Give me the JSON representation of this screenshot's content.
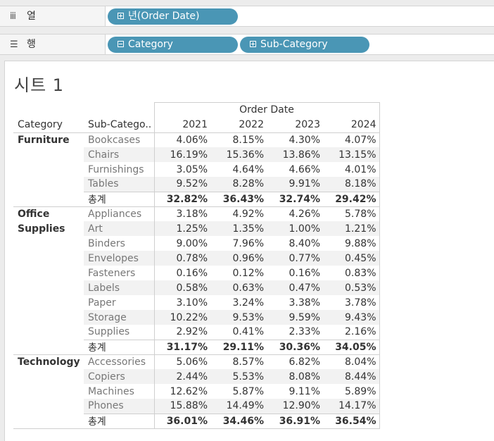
{
  "columns_shelf": {
    "label": "열",
    "icon": "columns-icon",
    "pill": "년(Order Date)"
  },
  "rows_shelf": {
    "label": "행",
    "icon": "rows-icon",
    "pills": [
      "Category",
      "Sub-Category"
    ]
  },
  "sheet": {
    "title": "시트 1",
    "column_group_header": "Order Date",
    "row_headers": [
      "Category",
      "Sub-Catego.."
    ],
    "years": [
      "2021",
      "2022",
      "2023",
      "2024"
    ],
    "total_label": "총계",
    "groups": [
      {
        "category": "Furniture",
        "rows": [
          {
            "sub": "Bookcases",
            "values": [
              "4.06%",
              "8.15%",
              "4.30%",
              "4.07%"
            ]
          },
          {
            "sub": "Chairs",
            "values": [
              "16.19%",
              "15.36%",
              "13.86%",
              "13.15%"
            ]
          },
          {
            "sub": "Furnishings",
            "values": [
              "3.05%",
              "4.64%",
              "4.66%",
              "4.01%"
            ]
          },
          {
            "sub": "Tables",
            "values": [
              "9.52%",
              "8.28%",
              "9.91%",
              "8.18%"
            ]
          }
        ],
        "total": [
          "32.82%",
          "36.43%",
          "32.74%",
          "29.42%"
        ]
      },
      {
        "category": "Office Supplies",
        "category_lines": [
          "Office",
          "Supplies"
        ],
        "rows": [
          {
            "sub": "Appliances",
            "values": [
              "3.18%",
              "4.92%",
              "4.26%",
              "5.78%"
            ]
          },
          {
            "sub": "Art",
            "values": [
              "1.25%",
              "1.35%",
              "1.00%",
              "1.21%"
            ]
          },
          {
            "sub": "Binders",
            "values": [
              "9.00%",
              "7.96%",
              "8.40%",
              "9.88%"
            ]
          },
          {
            "sub": "Envelopes",
            "values": [
              "0.78%",
              "0.96%",
              "0.77%",
              "0.45%"
            ]
          },
          {
            "sub": "Fasteners",
            "values": [
              "0.16%",
              "0.12%",
              "0.16%",
              "0.83%"
            ]
          },
          {
            "sub": "Labels",
            "values": [
              "0.58%",
              "0.63%",
              "0.47%",
              "0.53%"
            ]
          },
          {
            "sub": "Paper",
            "values": [
              "3.10%",
              "3.24%",
              "3.38%",
              "3.78%"
            ]
          },
          {
            "sub": "Storage",
            "values": [
              "10.22%",
              "9.53%",
              "9.59%",
              "9.43%"
            ]
          },
          {
            "sub": "Supplies",
            "values": [
              "2.92%",
              "0.41%",
              "2.33%",
              "2.16%"
            ]
          }
        ],
        "total": [
          "31.17%",
          "29.11%",
          "30.36%",
          "34.05%"
        ]
      },
      {
        "category": "Technology",
        "rows": [
          {
            "sub": "Accessories",
            "values": [
              "5.06%",
              "8.57%",
              "6.82%",
              "8.04%"
            ]
          },
          {
            "sub": "Copiers",
            "values": [
              "2.44%",
              "5.53%",
              "8.08%",
              "8.44%"
            ]
          },
          {
            "sub": "Machines",
            "values": [
              "12.62%",
              "5.87%",
              "9.11%",
              "5.89%"
            ]
          },
          {
            "sub": "Phones",
            "values": [
              "15.88%",
              "14.49%",
              "12.90%",
              "14.17%"
            ]
          }
        ],
        "total": [
          "36.01%",
          "34.46%",
          "36.91%",
          "36.54%"
        ]
      }
    ]
  }
}
